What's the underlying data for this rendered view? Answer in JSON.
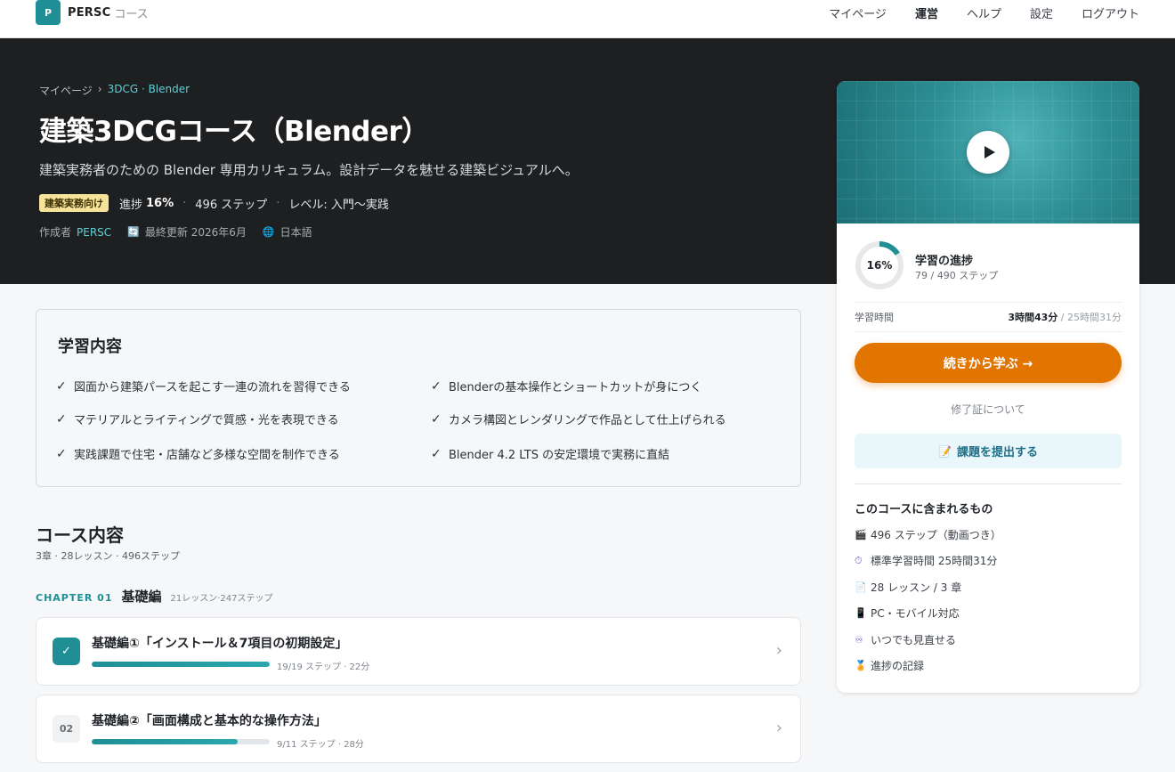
{
  "nav": {
    "logo_badge": "P",
    "logo_text": "PERSC",
    "logo_sub": "コース",
    "links": [
      "マイページ",
      "運営",
      "ヘルプ",
      "設定",
      "ログアウト"
    ]
  },
  "hero": {
    "breadcrumb": [
      "マイページ",
      "›",
      "3DCG · Blender"
    ],
    "title": "建築3DCGコース（Blender）",
    "subtitle": "建築実務者のための Blender 専用カリキュラム。設計データを魅せる建築ビジュアルへ。",
    "tag": "建築実務向け",
    "progress_label": "進捗",
    "progress_value": "16%",
    "steps": "496 ステップ",
    "level": "レベル: 入門〜実践",
    "author_label": "作成者",
    "author": "PERSC",
    "updated": "最終更新 2026年6月",
    "language": "日本語"
  },
  "learn": {
    "heading": "学習内容",
    "items": [
      "図面から建築パースを起こす一連の流れを習得できる",
      "Blenderの基本操作とショートカットが身につく",
      "マテリアルとライティングで質感・光を表現できる",
      "カメラ構図とレンダリングで作品として仕上げられる",
      "実践課題で住宅・店舗など多様な空間を制作できる",
      "Blender 4.2 LTS の安定環境で実務に直結"
    ]
  },
  "course": {
    "heading": "コース内容",
    "summary": "3章 · 28レッスン · 496ステップ",
    "chapter_label": "CHAPTER 01",
    "chapter_name": "基礎編",
    "chapter_count": "21レッスン·247ステップ",
    "lessons": [
      {
        "badge": "✓",
        "title": "基礎編①「インストール＆7項目の初期設定」",
        "meta": "19/19 ステップ · 22分",
        "progress": 1.0
      },
      {
        "badge": "02",
        "title": "基礎編②「画面構成と基本的な操作方法」",
        "meta": "9/11 ステップ · 28分",
        "progress": 0.82
      }
    ]
  },
  "sidebar": {
    "ring_value": "16%",
    "ring_fraction": 0.16,
    "progress_title": "学習の進捗",
    "progress_sub": "79 / 490 ステップ",
    "time_label": "学習時間",
    "time_value": "3時間43分",
    "time_total": "/ 25時間31分",
    "cta": "続きから学ぶ →",
    "cert_link": "修了証について",
    "submit": "課題を提出する",
    "include_title": "このコースに含まれるもの",
    "includes": [
      {
        "icon": "🎬",
        "text": "496 ステップ（動画つき）"
      },
      {
        "icon": "⏱",
        "text": "標準学習時間 25時間31分"
      },
      {
        "icon": "📄",
        "text": "28 レッスン / 3 章"
      },
      {
        "icon": "📱",
        "text": "PC・モバイル対応"
      },
      {
        "icon": "♾",
        "text": "いつでも見直せる"
      },
      {
        "icon": "🏅",
        "text": "進捗の記録"
      }
    ]
  },
  "colors": {
    "accent": "#1f8f95",
    "cta": "#e27400",
    "hero_bg": "#1e1f21"
  }
}
